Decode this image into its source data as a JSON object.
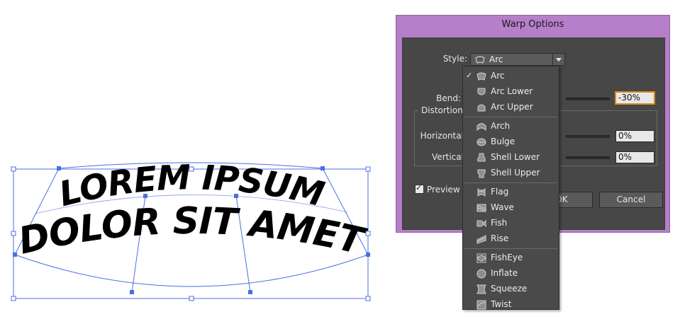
{
  "artwork": {
    "line1": "LOREM IPSUM",
    "line2": "DOLOR SIT AMET"
  },
  "dialog": {
    "title": "Warp Options",
    "style_label": "Style:",
    "style_value": "Arc",
    "bend_label": "Bend:",
    "bend_value": "-30%",
    "distortion_legend": "Distortion",
    "horizontal_label": "Horizontal:",
    "horizontal_value": "0%",
    "vertical_label": "Vertical:",
    "vertical_value": "0%",
    "preview_label": "Preview",
    "preview_checked": true,
    "ok_label": "OK",
    "cancel_label": "Cancel"
  },
  "style_menu": {
    "selected": "Arc",
    "groups": [
      [
        {
          "label": "Arc",
          "icon": "arc-icon",
          "checked": true
        },
        {
          "label": "Arc Lower",
          "icon": "arc-lower-icon"
        },
        {
          "label": "Arc Upper",
          "icon": "arc-upper-icon"
        }
      ],
      [
        {
          "label": "Arch",
          "icon": "arch-icon"
        },
        {
          "label": "Bulge",
          "icon": "bulge-icon"
        },
        {
          "label": "Shell Lower",
          "icon": "shell-lower-icon"
        },
        {
          "label": "Shell Upper",
          "icon": "shell-upper-icon"
        }
      ],
      [
        {
          "label": "Flag",
          "icon": "flag-icon"
        },
        {
          "label": "Wave",
          "icon": "wave-icon"
        },
        {
          "label": "Fish",
          "icon": "fish-icon"
        },
        {
          "label": "Rise",
          "icon": "rise-icon"
        }
      ],
      [
        {
          "label": "FishEye",
          "icon": "fisheye-icon"
        },
        {
          "label": "Inflate",
          "icon": "inflate-icon"
        },
        {
          "label": "Squeeze",
          "icon": "squeeze-icon"
        },
        {
          "label": "Twist",
          "icon": "twist-icon"
        }
      ]
    ]
  },
  "colors": {
    "dialog_frame": "#b57fc9",
    "dialog_panel": "#474747",
    "selection_blue": "#4a6fe0",
    "focus_orange": "#d98b1f"
  }
}
